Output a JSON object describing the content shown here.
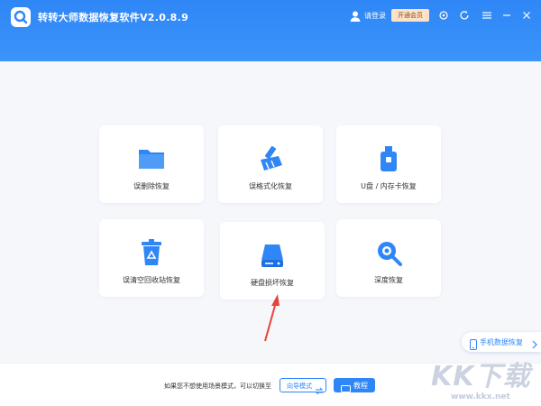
{
  "header": {
    "title": "转转大师数据恢复软件V2.0.8.9",
    "login_label": "请登录",
    "vip_label": "开通会员"
  },
  "cards": [
    {
      "label": "误删除恢复",
      "icon": "folder-icon"
    },
    {
      "label": "误格式化恢复",
      "icon": "format-icon"
    },
    {
      "label": "U盘 / 内存卡恢复",
      "icon": "usb-drive-icon"
    },
    {
      "label": "误清空回收站恢复",
      "icon": "recycle-bin-icon"
    },
    {
      "label": "硬盘损坏恢复",
      "icon": "hard-disk-icon"
    },
    {
      "label": "深度恢复",
      "icon": "deep-scan-icon"
    }
  ],
  "side": {
    "phone_label": "手机数据恢复"
  },
  "footer": {
    "hint": "如果您不想使用场景模式，可以切换至",
    "guide_label": "向导模式",
    "tutorial_label": "教程"
  },
  "watermark": {
    "text": "KK下载",
    "url": "www.kkx.net"
  },
  "colors": {
    "accent": "#2f86f6",
    "vip_bg": "#fde2c9",
    "arrow": "#e8433a"
  }
}
